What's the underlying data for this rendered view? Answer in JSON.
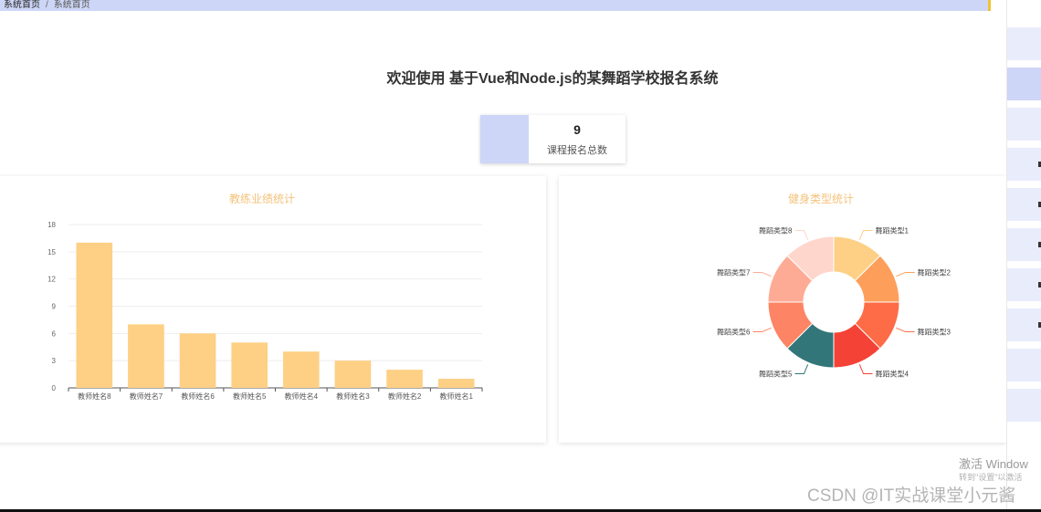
{
  "breadcrumb": {
    "home": "系统首页",
    "separator": "/",
    "current": "系统首页"
  },
  "welcome_title": "欢迎使用 基于Vue和Node.js的某舞蹈学校报名系统",
  "stat": {
    "value": "9",
    "label": "课程报名总数"
  },
  "colors": {
    "accent": "#cdd6f6",
    "title": "#f4c27a",
    "bar": "#fdd085",
    "highlight": "#f1c232"
  },
  "chart_data": [
    {
      "type": "bar",
      "title": "教练业绩统计",
      "categories": [
        "教师姓名8",
        "教师姓名7",
        "教师姓名6",
        "教师姓名5",
        "教师姓名4",
        "教师姓名3",
        "教师姓名2",
        "教师姓名1"
      ],
      "values": [
        16,
        7,
        6,
        5,
        4,
        3,
        2,
        1
      ],
      "yticks": [
        "0",
        "3",
        "6",
        "9",
        "12",
        "15",
        "18"
      ],
      "ylim": [
        0,
        18
      ],
      "grid": true
    },
    {
      "type": "pie",
      "title": "健身类型统计",
      "donut": true,
      "labels": [
        "舞蹈类型1",
        "舞蹈类型2",
        "舞蹈类型3",
        "舞蹈类型4",
        "舞蹈类型5",
        "舞蹈类型6",
        "舞蹈类型7",
        "舞蹈类型8"
      ],
      "values": [
        1,
        1,
        1,
        1,
        1,
        1,
        1,
        1
      ],
      "colors": [
        "#fdd085",
        "#fd9f5a",
        "#fd6c46",
        "#f54236",
        "#327679",
        "#fd8464",
        "#feab96",
        "#fed6cb"
      ]
    }
  ],
  "watermark": {
    "windows_line1": "激活 Window",
    "windows_line2": "转到\"设置\"以激活",
    "csdn": "CSDN @IT实战课堂小元酱"
  }
}
